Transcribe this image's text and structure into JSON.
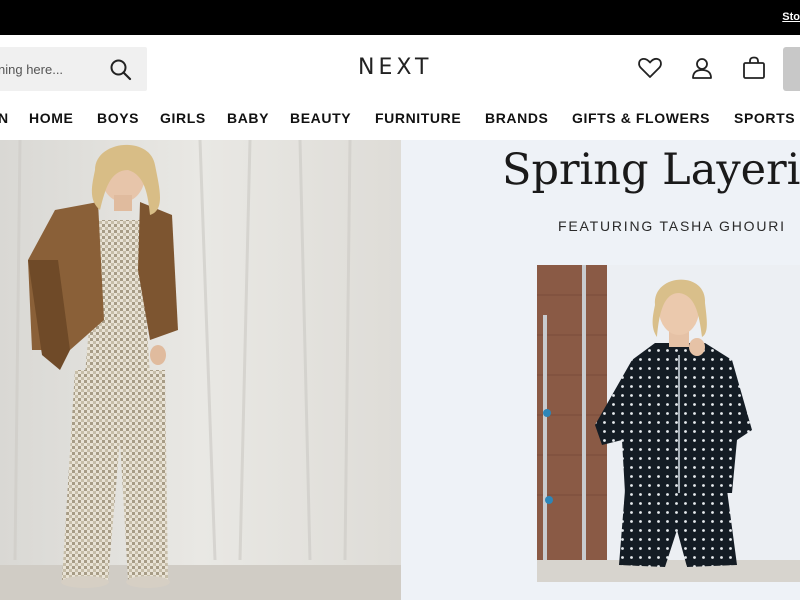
{
  "topbar": {
    "store_link": "Sto"
  },
  "search": {
    "placeholder": "ning here..."
  },
  "header": {
    "logo": "NEXT",
    "icons": [
      "heart-icon",
      "user-icon",
      "bag-icon",
      "search-icon"
    ]
  },
  "nav": {
    "items": [
      "N",
      "HOME",
      "BOYS",
      "GIRLS",
      "BABY",
      "BEAUTY",
      "FURNITURE",
      "BRANDS",
      "GIFTS & FLOWERS",
      "SPORTS"
    ]
  },
  "hero": {
    "headline": "Spring Layering",
    "subheadline": "FEATURING TASHA GHOURI"
  },
  "colors": {
    "topbar": "#000000",
    "right_panel_bg": "#eef2f7",
    "search_bg": "#f0f0f0",
    "text": "#111111"
  }
}
